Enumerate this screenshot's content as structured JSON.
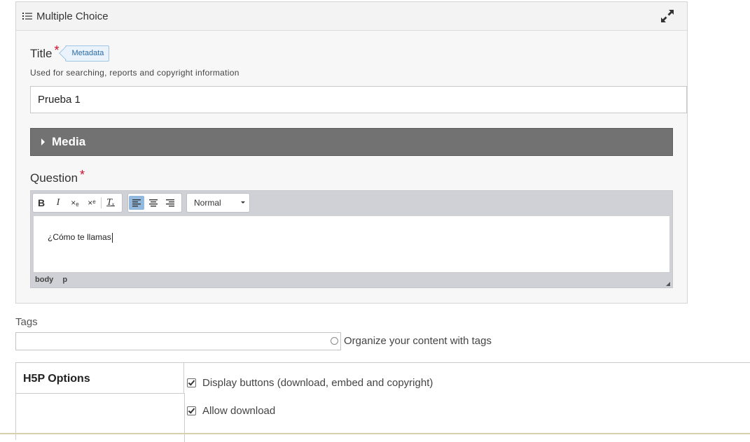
{
  "editor": {
    "header_title": "Multiple Choice",
    "header_icon": "list-icon",
    "expand_icon": "expand-icon"
  },
  "title_field": {
    "label": "Title",
    "required_mark": "*",
    "metadata_tag": "Metadata",
    "description": "Used for searching, reports and copyright information",
    "value": "Prueba 1"
  },
  "media": {
    "label": "Media",
    "expanded": false
  },
  "question_field": {
    "label": "Question",
    "required_mark": "*",
    "toolbar": {
      "bold": "B",
      "italic": "I",
      "subscript": "×ₑ",
      "superscript": "×ᵉ",
      "remove_format": "Tₓ",
      "format_select": "Normal"
    },
    "content": "¿Cómo te llamas",
    "path": [
      "body",
      "p"
    ]
  },
  "tags": {
    "label": "Tags",
    "placeholder": "",
    "hint": "Organize your content with tags"
  },
  "h5p_options": {
    "tab_label": "H5P Options",
    "options": [
      {
        "label": "Display buttons (download, embed and copyright)",
        "checked": true
      },
      {
        "label": "Allow download",
        "checked": true
      }
    ]
  }
}
